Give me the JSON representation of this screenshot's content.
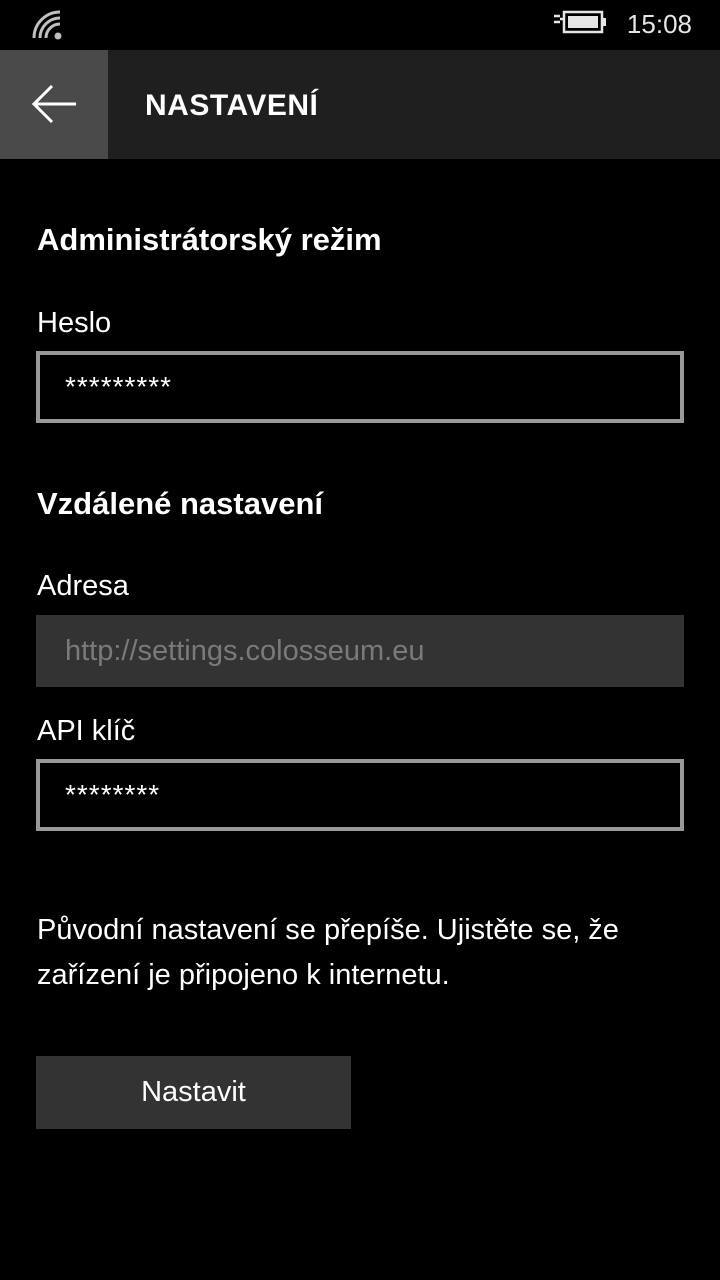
{
  "status_bar": {
    "time": "15:08",
    "icons": [
      "wifi-icon",
      "battery-charging-icon"
    ]
  },
  "header": {
    "back_icon": "back-arrow-icon",
    "title": "NASTAVENÍ",
    "colors": {
      "background": "#1f1f1f",
      "back_button": "#4a4a4a"
    }
  },
  "admin_section": {
    "title": "Administrátorský režim",
    "password_label": "Heslo",
    "password_value": "*********"
  },
  "remote_section": {
    "title": "Vzdálené nastavení",
    "address_label": "Adresa",
    "address_placeholder": "http://settings.colosseum.eu",
    "api_key_label": "API klíč",
    "api_key_value": "********"
  },
  "info_text": "Původní nastavení se přepíše. Ujistěte se, že zařízení je připojeno k internetu.",
  "submit_button": {
    "label": "Nastavit"
  },
  "colors": {
    "background": "#000000",
    "field_border": "#999999",
    "disabled_field": "#333333",
    "button": "#333333"
  }
}
